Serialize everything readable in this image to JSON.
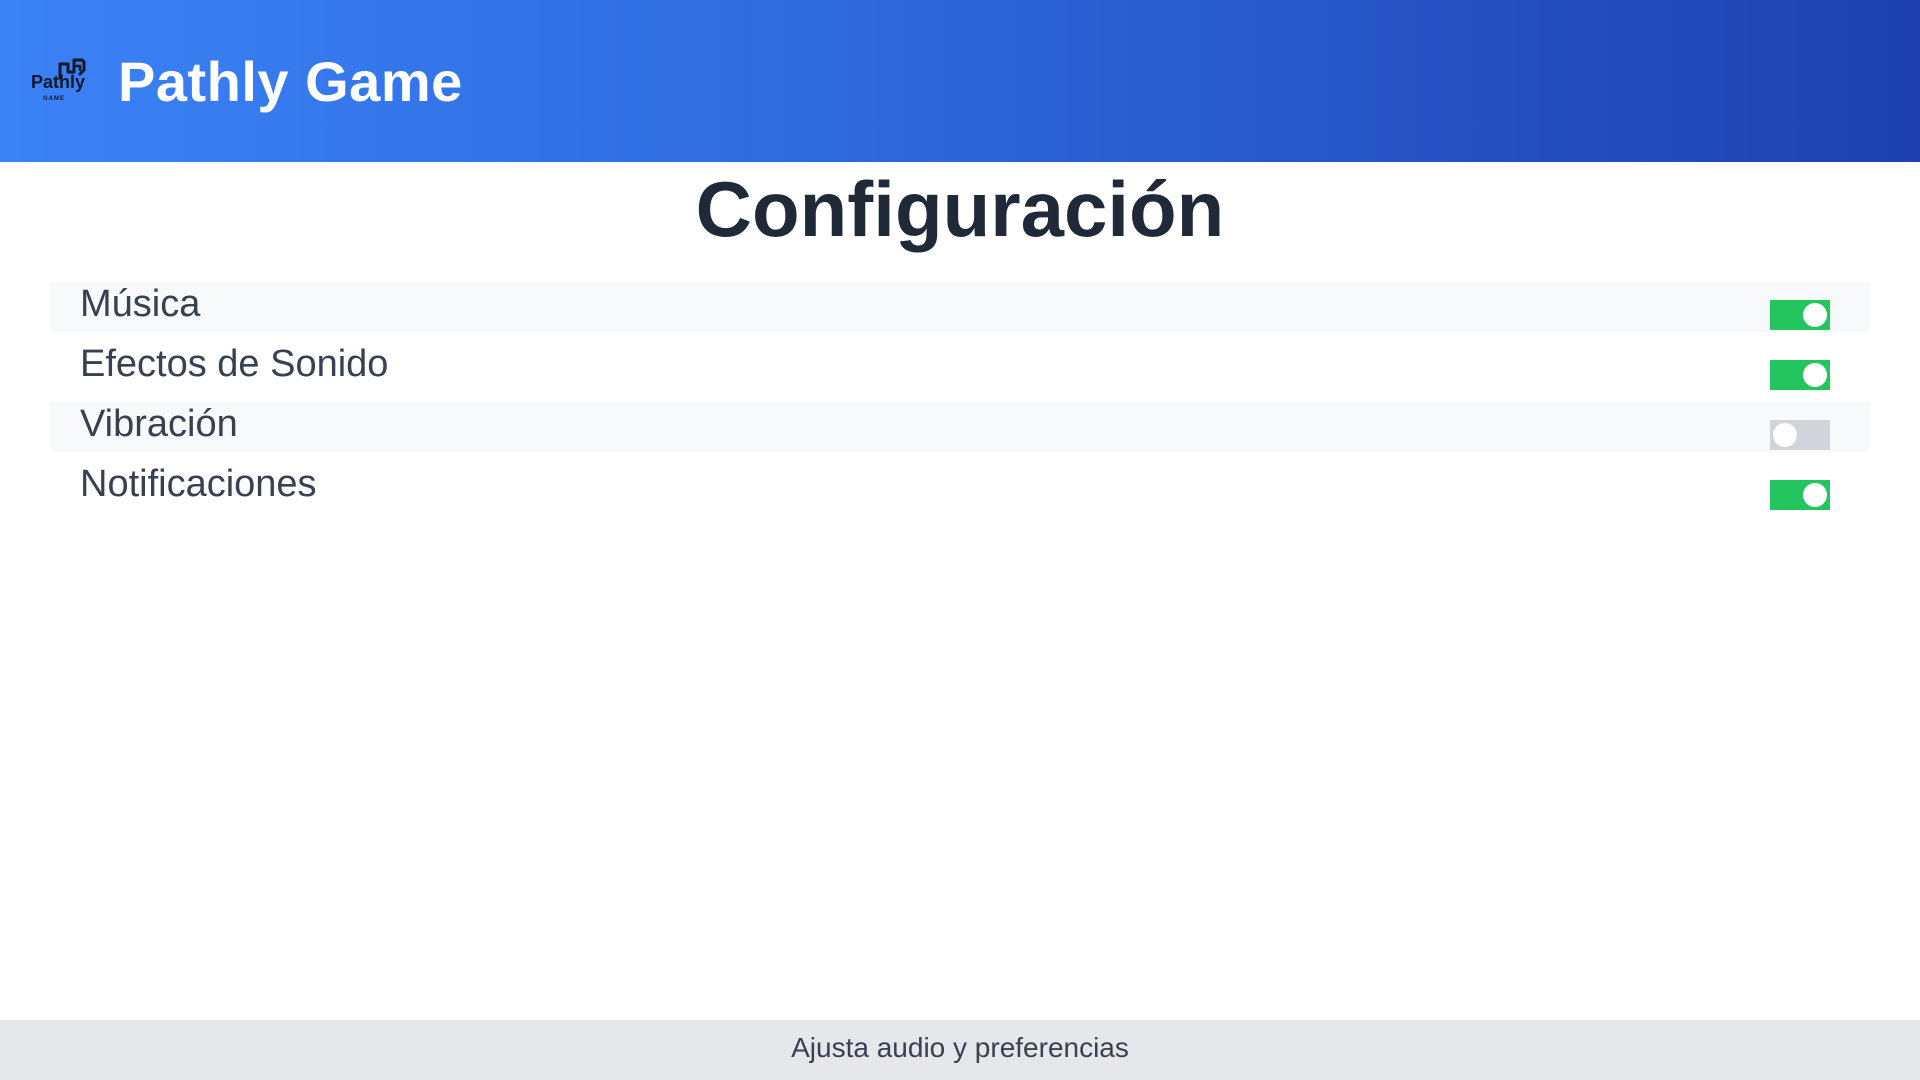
{
  "header": {
    "app_title": "Pathly Game",
    "logo_text": "Pathly",
    "logo_subtext": "GAME",
    "gradient_start": "#3b82f6",
    "gradient_end": "#1e40af"
  },
  "main": {
    "title": "Configuración",
    "settings": [
      {
        "label": "Música",
        "enabled": true
      },
      {
        "label": "Efectos de Sonido",
        "enabled": true
      },
      {
        "label": "Vibración",
        "enabled": false
      },
      {
        "label": "Notificaciones",
        "enabled": true
      }
    ],
    "toggle_on_color": "#22c55e",
    "toggle_off_color": "#d1d5db"
  },
  "footer": {
    "text": "Ajusta audio y preferencias"
  }
}
